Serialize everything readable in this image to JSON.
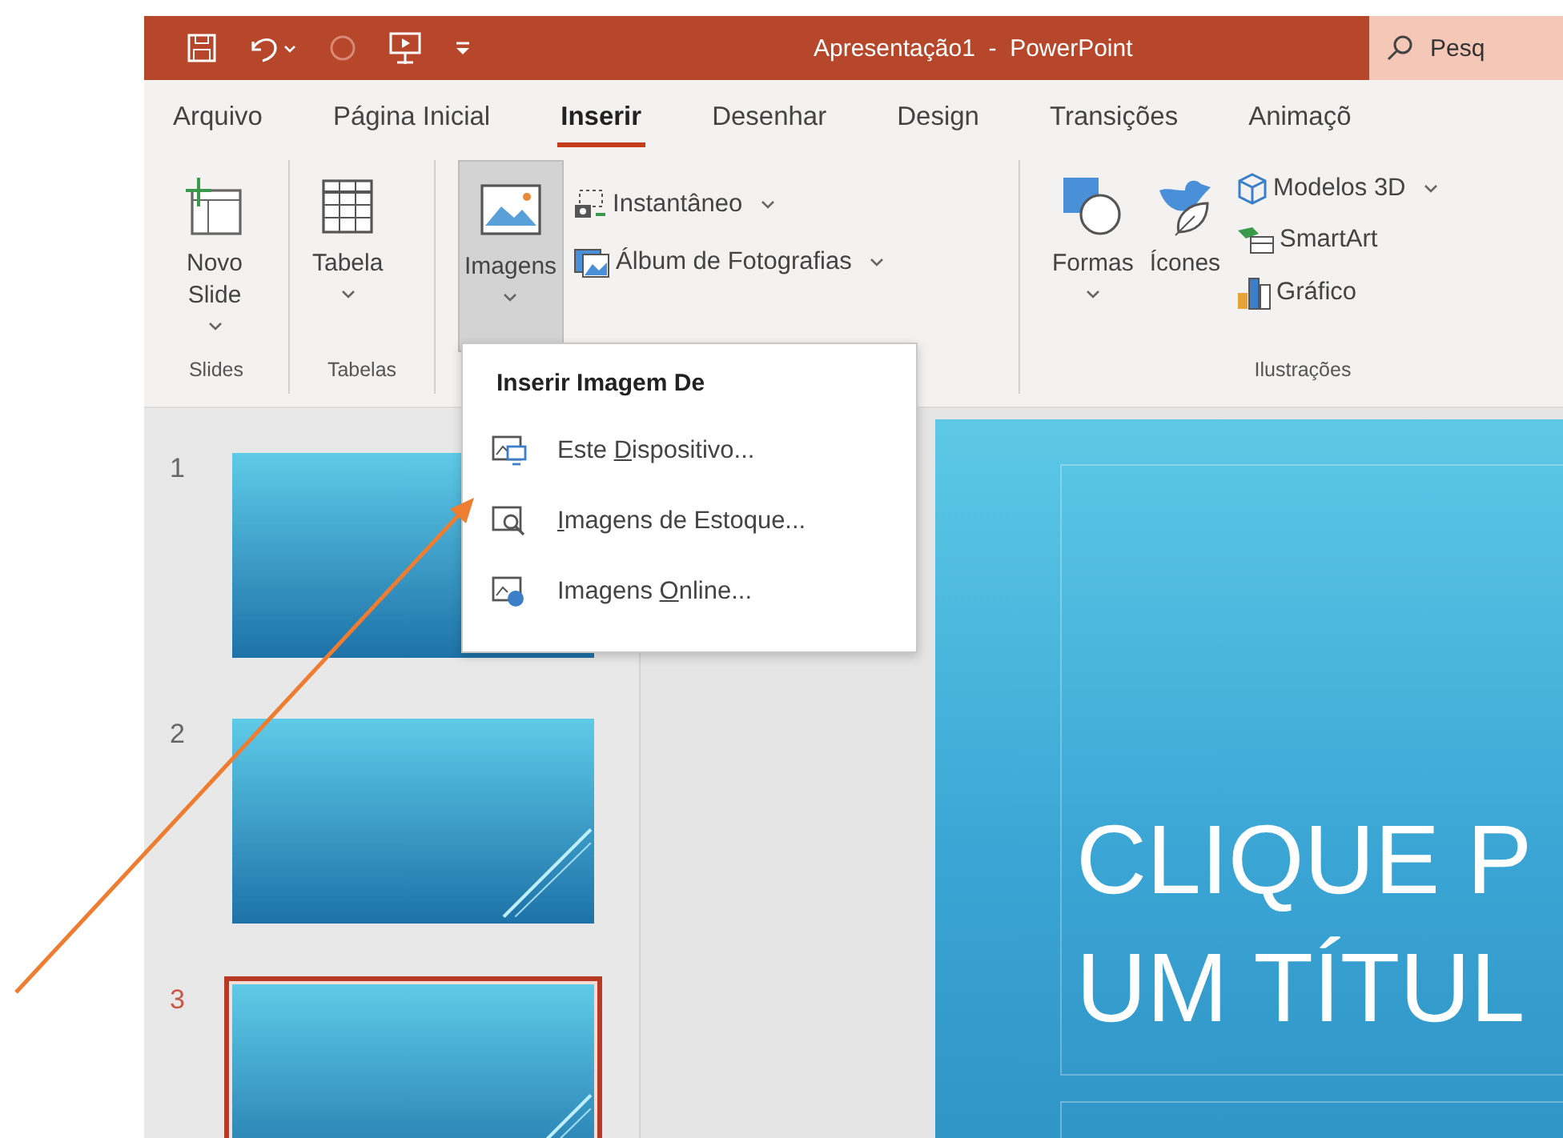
{
  "title_bar": {
    "title": "Apresentação1  -  PowerPoint",
    "search": {
      "placeholder": "Pesq"
    }
  },
  "tabs": [
    {
      "label": "Arquivo",
      "selected": false
    },
    {
      "label": "Página Inicial",
      "selected": false
    },
    {
      "label": "Inserir",
      "selected": true
    },
    {
      "label": "Desenhar",
      "selected": false
    },
    {
      "label": "Design",
      "selected": false
    },
    {
      "label": "Transições",
      "selected": false
    },
    {
      "label": "Animaçõ",
      "selected": false
    }
  ],
  "ribbon": {
    "groups": [
      {
        "label": "Slides",
        "buttons": [
          {
            "label": "Novo Slide",
            "dropdown": true,
            "selected": false
          }
        ]
      },
      {
        "label": "Tabelas",
        "buttons": [
          {
            "label": "Tabela",
            "dropdown": true,
            "selected": false
          }
        ]
      },
      {
        "buttons": [
          {
            "label": "Imagens",
            "dropdown": true,
            "selected": true
          }
        ],
        "small_buttons": [
          {
            "label": "Instantâneo",
            "dropdown": true
          },
          {
            "label": "Álbum de Fotografias",
            "dropdown": true
          }
        ]
      },
      {
        "label": "Ilustrações",
        "buttons": [
          {
            "label": "Formas",
            "dropdown": true,
            "selected": false
          },
          {
            "label": "Ícones",
            "dropdown": false,
            "selected": false
          }
        ],
        "small_buttons": [
          {
            "label": "Modelos 3D",
            "dropdown": true
          },
          {
            "label": "SmartArt",
            "dropdown": false
          },
          {
            "label": "Gráfico",
            "dropdown": false
          }
        ]
      }
    ]
  },
  "menu": {
    "title": "Inserir Imagem De",
    "items": [
      {
        "before": "Este ",
        "accel": "D",
        "after": "ispositivo..."
      },
      {
        "accel": "I",
        "after": "magens de Estoque..."
      },
      {
        "before": "Imagens ",
        "accel": "O",
        "after": "nline..."
      }
    ]
  },
  "slides_panel": {
    "slides": [
      {
        "number": "1",
        "selected": false
      },
      {
        "number": "2",
        "selected": false
      },
      {
        "number": "3",
        "selected": true
      }
    ]
  },
  "slide": {
    "title_lines": [
      "CLIQUE P",
      "UM TÍTUL"
    ]
  }
}
